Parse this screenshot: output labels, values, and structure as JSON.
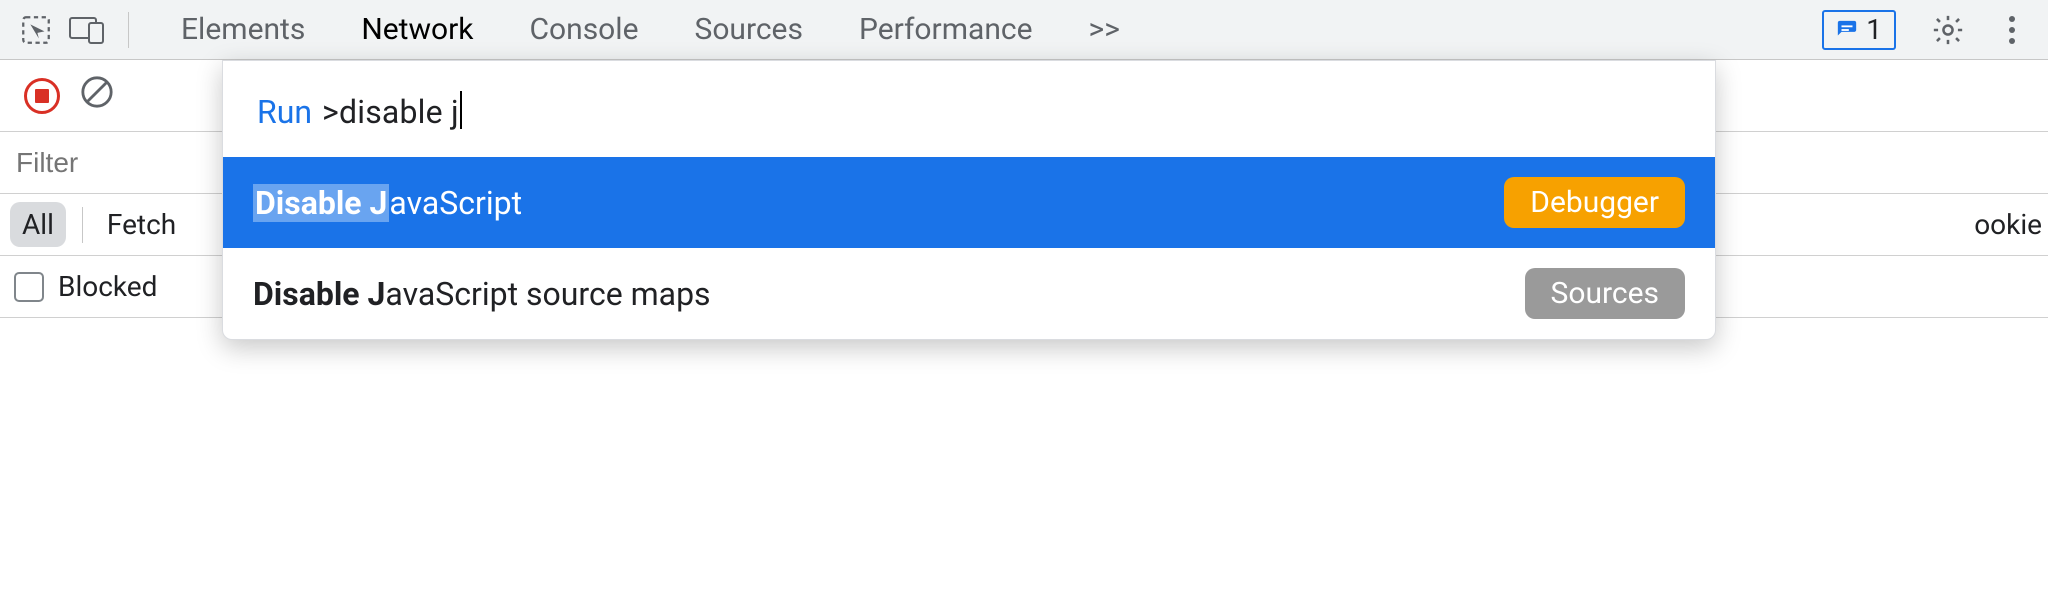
{
  "tabs": {
    "elements": "Elements",
    "network": "Network",
    "console": "Console",
    "sources": "Sources",
    "performance": "Performance",
    "overflow": ">>"
  },
  "issues_count": "1",
  "filter_placeholder": "Filter",
  "type_chips": {
    "all": "All",
    "fetch": "Fetch"
  },
  "cookies_truncated": "ookie",
  "blocked_label": "Blocked",
  "palette": {
    "run_label": "Run",
    "query": ">disable j",
    "items": [
      {
        "title_bold": "Disable J",
        "title_rest": "avaScript",
        "badge": "Debugger"
      },
      {
        "title_bold": "Disable J",
        "title_rest": "avaScript source maps",
        "badge": "Sources"
      }
    ]
  }
}
